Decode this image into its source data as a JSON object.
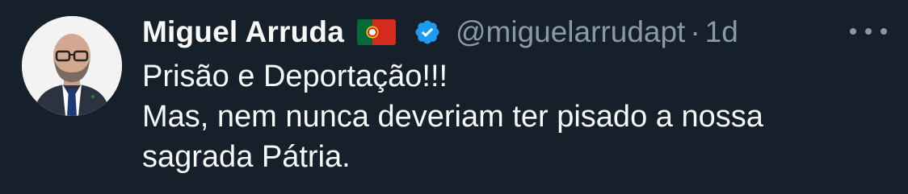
{
  "tweet": {
    "author_name": "Miguel Arruda",
    "flag_icon": "portugal-flag-icon",
    "verified_icon": "verified-badge-icon",
    "handle": "@miguelarrudapt",
    "separator": "·",
    "timestamp": "1d",
    "more_icon": "more-options-icon",
    "text_lines": [
      "Prisão e Deportação!!!",
      "Mas, nem nunca deveriam ter pisado a nossa",
      "sagrada Pátria."
    ]
  },
  "colors": {
    "background": "#15202b",
    "primary_text": "#f7f9f9",
    "secondary_text": "#8b98a5",
    "verified_blue": "#1d9bf0"
  }
}
